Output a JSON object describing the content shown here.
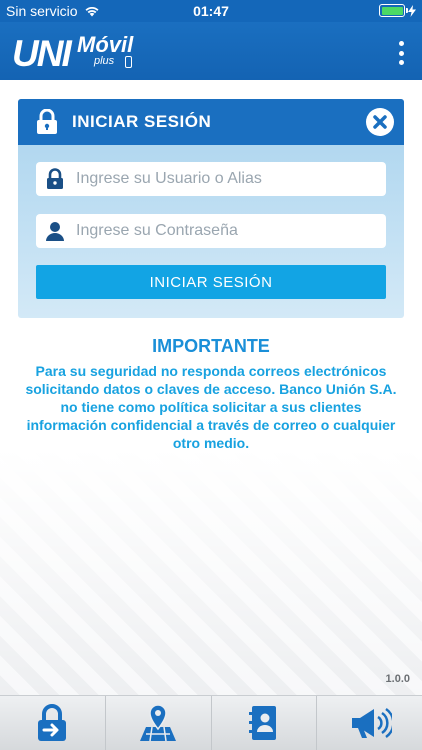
{
  "status_bar": {
    "carrier": "Sin servicio",
    "time": "01:47",
    "battery_level": 1.0,
    "battery_color": "#4cd964"
  },
  "header": {
    "logo_uni": "UNI",
    "logo_movil": "Móvil",
    "logo_plus": "plus",
    "menu_icon": "kebab-menu-icon",
    "background_color": "#1467b9"
  },
  "login": {
    "title": "INICIAR SESIÓN",
    "user_placeholder": "Ingrese su Usuario o Alias",
    "password_placeholder": "Ingrese su Contraseña",
    "user_value": "",
    "password_value": "",
    "submit_label": "INICIAR  SESIÓN",
    "header_color": "#1a6fc0",
    "button_color": "#12a4e4"
  },
  "notice": {
    "title": "IMPORTANTE",
    "body": "Para su seguridad no responda correos electrónicos solicitando datos o claves de acceso. Banco Unión S.A. no tiene como política solicitar a sus clientes información confidencial a través de correo o cualquier otro medio.",
    "text_color": "#18a2e0"
  },
  "version": "1.0.0",
  "bottom_nav": {
    "items": [
      {
        "icon": "lock-login-icon"
      },
      {
        "icon": "map-location-icon"
      },
      {
        "icon": "contacts-book-icon"
      },
      {
        "icon": "megaphone-icon"
      }
    ]
  }
}
